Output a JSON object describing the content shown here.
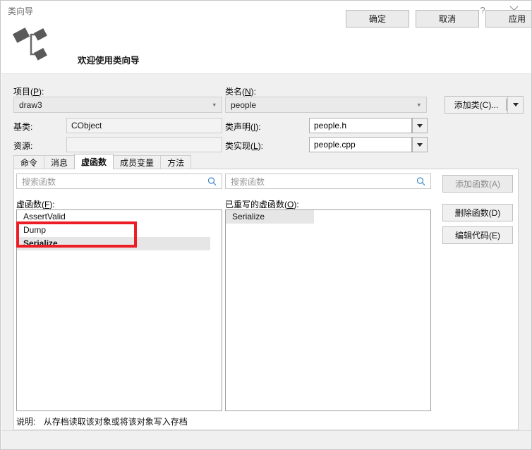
{
  "window": {
    "title": "类向导",
    "help_label": "?",
    "close_label": "×"
  },
  "banner": {
    "heading": "欢迎使用类向导",
    "icon": "class-wizard-icon"
  },
  "form": {
    "project_label_pre": "项目(",
    "project_label_key": "P",
    "project_label_post": "):",
    "project_value": "draw3",
    "base_class_label": "基类:",
    "base_class_value": "CObject",
    "resource_label": "资源:",
    "resource_value": "",
    "class_name_label_pre": "类名(",
    "class_name_label_key": "N",
    "class_name_label_post": "):",
    "class_name_value": "people",
    "declaration_label_pre": "类声明(",
    "declaration_label_key": "I",
    "declaration_label_post": "):",
    "declaration_value": "people.h",
    "implementation_label_pre": "类实现(",
    "implementation_label_key": "L",
    "implementation_label_post": "):",
    "implementation_value": "people.cpp",
    "add_class_label": "添加类(C)...",
    "add_class_split_icon": "chevron-down-icon"
  },
  "tabs": [
    {
      "label": "命令",
      "selected": false
    },
    {
      "label": "消息",
      "selected": false
    },
    {
      "label": "虚函数",
      "selected": true
    },
    {
      "label": "成员变量",
      "selected": false
    },
    {
      "label": "方法",
      "selected": false
    }
  ],
  "left_pane": {
    "search_placeholder": "搜索函数",
    "search_value": "",
    "search_icon": "search-icon",
    "list_label_pre": "虚函数(",
    "list_label_key": "F",
    "list_label_post": "):",
    "items": [
      {
        "label": "AssertValid",
        "selected": false,
        "bold": false
      },
      {
        "label": "Dump",
        "selected": false,
        "bold": false
      },
      {
        "label": "Serialize",
        "selected": true,
        "bold": true
      }
    ]
  },
  "right_pane": {
    "search_placeholder": "搜索函数",
    "search_value": "",
    "search_icon": "search-icon",
    "list_label_pre": "已重写的虚函数(",
    "list_label_key": "O",
    "list_label_post": "):",
    "items": [
      {
        "label": "Serialize",
        "selected": true
      }
    ]
  },
  "actions": {
    "add_function": "添加函数(A)",
    "delete_function": "删除函数(D)",
    "edit_code": "编辑代码(E)"
  },
  "description": {
    "label": "说明:",
    "text": "从存档读取该对象或将该对象写入存档"
  },
  "footer": {
    "ok": "确定",
    "cancel": "取消",
    "apply": "应用"
  },
  "annotation": {
    "color": "#ee1c25",
    "target": "Serialize"
  }
}
